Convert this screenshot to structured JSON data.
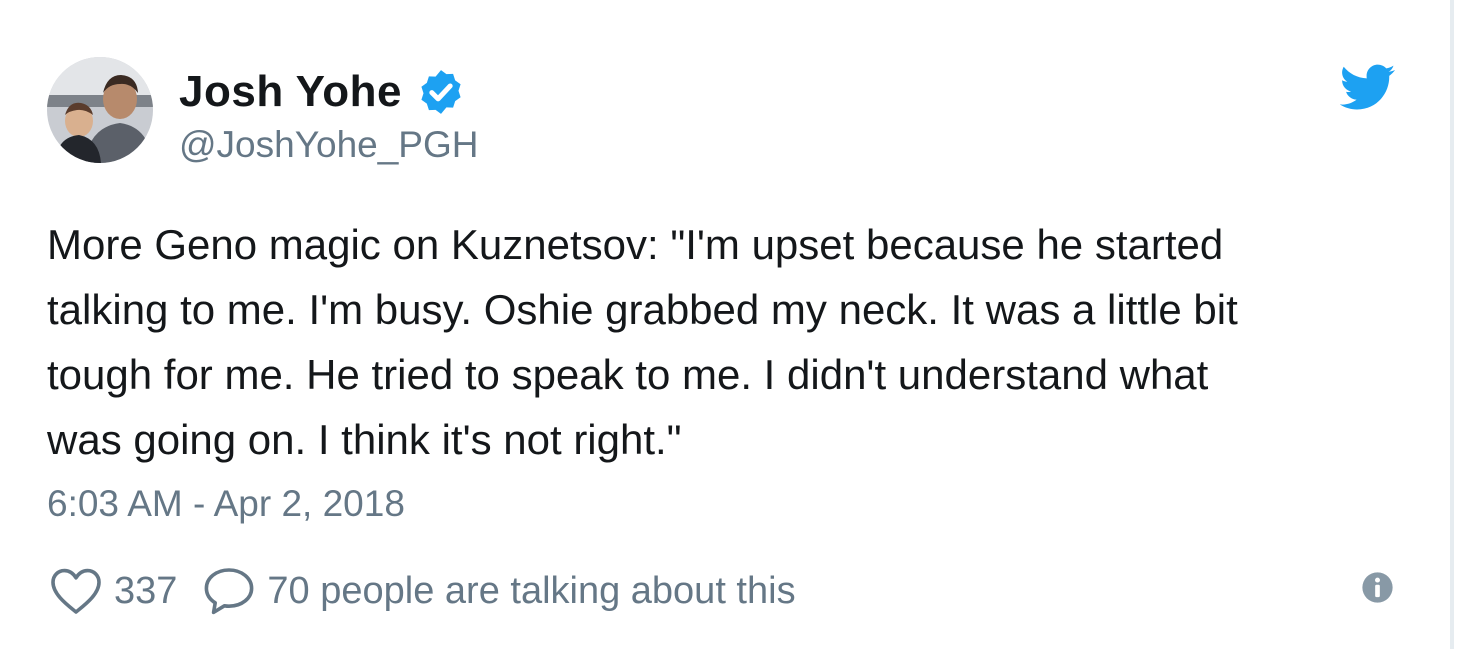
{
  "author": {
    "display_name": "Josh Yohe",
    "handle": "@JoshYohe_PGH",
    "verified": true,
    "avatar_icon": "profile-photo"
  },
  "tweet": {
    "text": "More Geno magic on Kuznetsov: \"I'm upset because he started\ntalking to me. I'm busy. Oshie grabbed my neck. It was a little bit\ntough for me. He tried to speak to me. I didn't understand what\nwas going on. I think it's not right.\"",
    "timestamp": "6:03 AM - Apr 2, 2018"
  },
  "actions": {
    "likes": "337",
    "conversation": "70 people are talking about this",
    "like_icon": "heart-icon",
    "reply_icon": "speech-bubble-icon",
    "info_icon": "info-icon"
  },
  "branding": {
    "logo_icon": "twitter-bird-icon"
  },
  "colors": {
    "brand": "#1da1f2",
    "text_primary": "#14171a",
    "text_secondary": "#657786"
  }
}
